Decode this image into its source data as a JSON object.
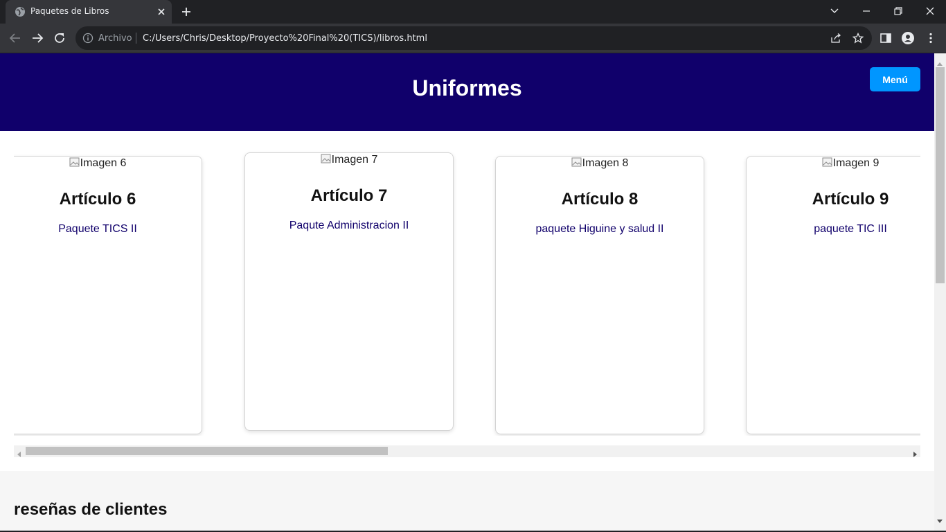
{
  "browser": {
    "tab_title": "Paquetes de Libros",
    "scheme_label": "Archivo",
    "url": "C:/Users/Chris/Desktop/Proyecto%20Final%20(TICS)/libros.html"
  },
  "header": {
    "title": "Uniformes",
    "menu_label": "Menú"
  },
  "cards": [
    {
      "img_alt": "Imagen 6",
      "title": "Artículo 6",
      "description": "Paquete TICS II"
    },
    {
      "img_alt": "Imagen 7",
      "title": "Artículo 7",
      "description": "Paqute Administracion II"
    },
    {
      "img_alt": "Imagen 8",
      "title": "Artículo 8",
      "description": "paquete Higuine y salud II"
    },
    {
      "img_alt": "Imagen 9",
      "title": "Artículo 9",
      "description": "paquete TIC III"
    }
  ],
  "reviews": {
    "title": "reseñas de clientes"
  },
  "colors": {
    "header_bg": "#10006b",
    "menu_button_bg": "#0096ff",
    "chrome_bg": "#202124",
    "toolbar_bg": "#35363a"
  }
}
